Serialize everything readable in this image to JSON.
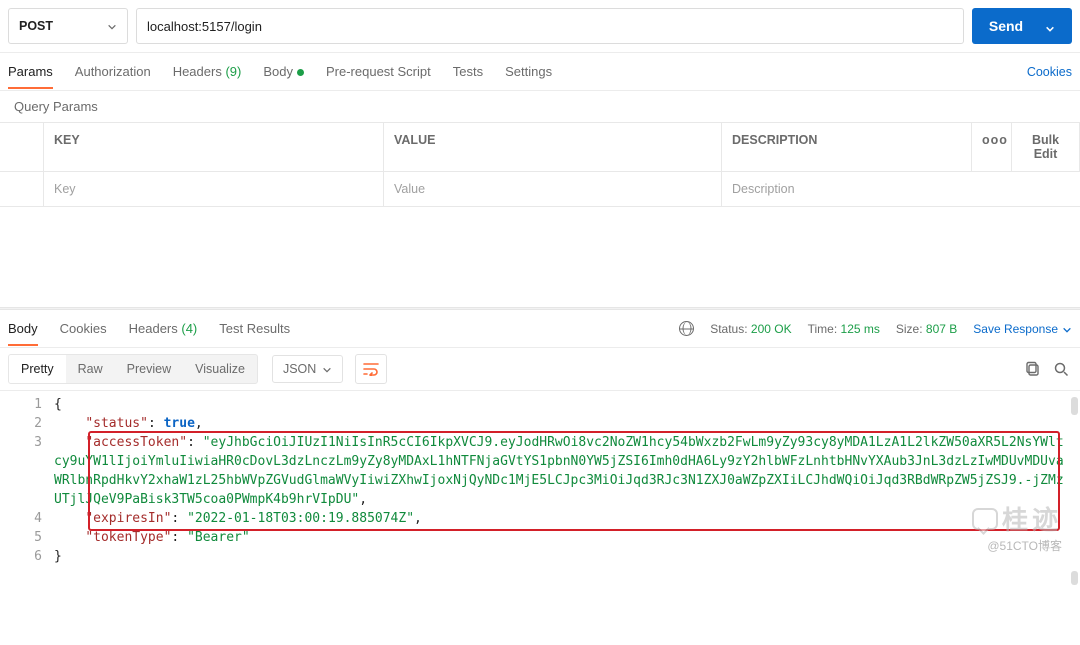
{
  "request": {
    "method": "POST",
    "url": "localhost:5157/login",
    "send_label": "Send"
  },
  "req_tabs": {
    "params": "Params",
    "auth": "Authorization",
    "headers_label": "Headers",
    "headers_count": "(9)",
    "body": "Body",
    "prereq": "Pre-request Script",
    "tests": "Tests",
    "settings": "Settings",
    "cookies": "Cookies"
  },
  "query_params_label": "Query Params",
  "param_headers": {
    "key": "KEY",
    "value": "VALUE",
    "desc": "DESCRIPTION",
    "menu": "ooo",
    "bulk": "Bulk Edit"
  },
  "param_placeholders": {
    "key": "Key",
    "value": "Value",
    "desc": "Description"
  },
  "resp_tabs": {
    "body": "Body",
    "cookies": "Cookies",
    "headers_label": "Headers",
    "headers_count": "(4)",
    "results": "Test Results"
  },
  "status": {
    "label": "Status:",
    "value": "200 OK",
    "time_label": "Time:",
    "time_value": "125 ms",
    "size_label": "Size:",
    "size_value": "807 B"
  },
  "save_response": "Save Response",
  "viewer": {
    "pretty": "Pretty",
    "raw": "Raw",
    "preview": "Preview",
    "visualize": "Visualize",
    "lang": "JSON"
  },
  "json": {
    "line1": "{",
    "status_key": "\"status\"",
    "status_val": "true",
    "access_key": "\"accessToken\"",
    "access_val": "\"eyJhbGciOiJIUzI1NiIsInR5cCI6IkpXVCJ9.eyJodHRwOi8vc2NoZW1hcy54bWxzb2FwLm9yZy93cy8yMDA1LzA1L2lkZW50aXR5L2NsYWltcy9uYW1lIjoiYmluIiwiaHR0cDovL3dzLnczLm9yZy8yMDAxL1hNTFNjaGVtYS1pbnN0YW5jZSI6Imh0dHA6Ly9zY2hlbWFzLnhtbHNvYXAub3JnL3dzLzIwMDUvMDUvaWRlbnRpdHkvY2xhaW1zL25hbWVpZGVudGlmaWVyIiwiZXhwIjoxNjQyNDc1MjE5LCJpc3MiOiJqd3RJc3N1ZXJ0aWZpZXIiLCJhdWQiOiJqd3RBdWRpZW5jZSJ9.-jZMzUTjlJQeV9PaBisk3TW5coa0PWmpK4b9hrVIpDU\"",
    "expires_key": "\"expiresIn\"",
    "expires_val": "\"2022-01-18T03:00:19.885074Z\"",
    "tokentype_key": "\"tokenType\"",
    "tokentype_val": "\"Bearer\"",
    "line6": "}",
    "ln1": "1",
    "ln2": "2",
    "ln3": "3",
    "ln4": "4",
    "ln5": "5",
    "ln6": "6"
  },
  "watermark": {
    "zh": "桂迹",
    "credit": "@51CTO博客"
  }
}
